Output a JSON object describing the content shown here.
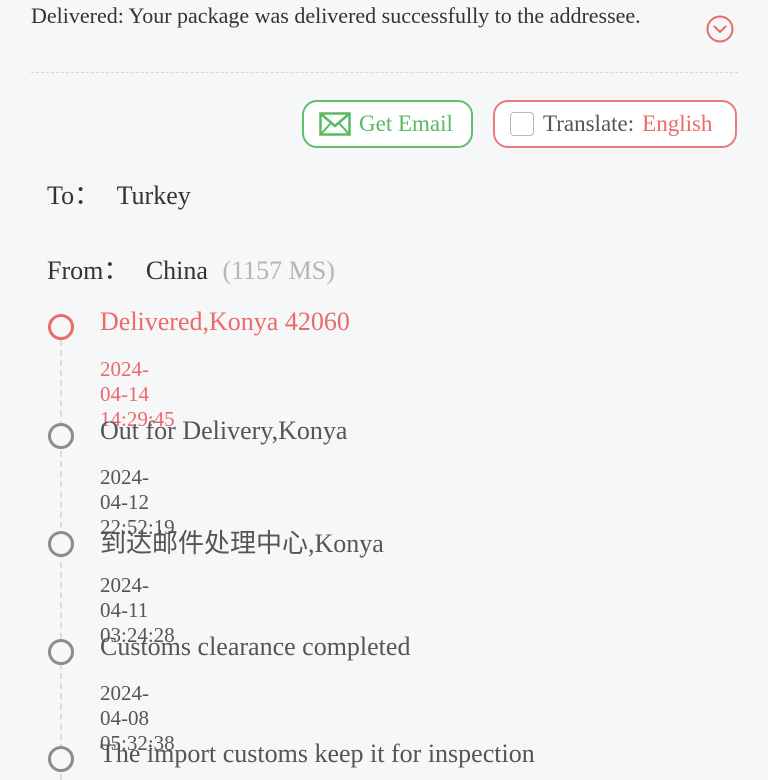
{
  "status_message": "Delivered: Your package was delivered successfully to the addressee.",
  "toolbar": {
    "email_label": "Get Email",
    "translate_label": "Translate:",
    "translate_language": "English"
  },
  "route": {
    "to_label": "To：",
    "to_value": "Turkey",
    "from_label": "From：",
    "from_value": "China",
    "from_extra": "(1157 MS)"
  },
  "events": [
    {
      "title": "Delivered,Konya 42060",
      "time": "2024-04-14 14:29:45",
      "active": true
    },
    {
      "title": "Out for Delivery,Konya",
      "time": "2024-04-12 22:52:19",
      "active": false
    },
    {
      "title": "到达邮件处理中心,Konya",
      "time": "2024-04-11 03:24:28",
      "active": false
    },
    {
      "title": "Customs clearance completed",
      "time": "2024-04-08 05:32:38",
      "active": false
    },
    {
      "title": "The import customs keep it for inspection",
      "time": "",
      "active": false
    }
  ],
  "colors": {
    "accent_red": "#ec6a6a",
    "accent_green": "#5bb865",
    "background": "#f6f7f9"
  },
  "icons": {
    "expand": "chevron-down-circle-icon",
    "email": "envelope-icon"
  }
}
